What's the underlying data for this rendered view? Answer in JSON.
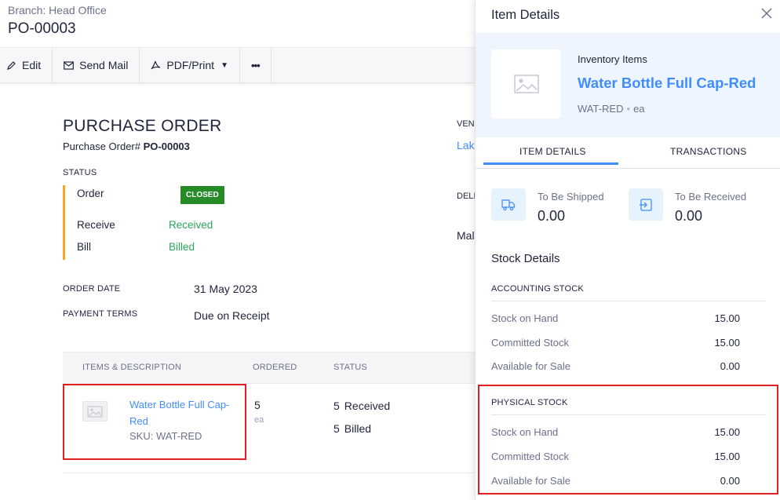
{
  "header": {
    "branch": "Branch: Head Office",
    "po_number": "PO-00003"
  },
  "toolbar": {
    "edit": "Edit",
    "send_mail": "Send Mail",
    "pdf_print": "PDF/Print",
    "more": "•••"
  },
  "document": {
    "title": "PURCHASE ORDER",
    "po_label": "Purchase Order#",
    "po_number": "PO-00003",
    "status_label": "STATUS",
    "status": {
      "order_label": "Order",
      "order_value": "CLOSED",
      "receive_label": "Receive",
      "receive_value": "Received",
      "bill_label": "Bill",
      "bill_value": "Billed"
    },
    "order_date_label": "ORDER DATE",
    "order_date": "31 May 2023",
    "payment_terms_label": "PAYMENT TERMS",
    "payment_terms": "Due on Receipt",
    "vendor_cut": "VEN",
    "vendor_link_cut": "Lak",
    "deliver_cut": "DELI",
    "deliver_val_cut": "Mal"
  },
  "items_table": {
    "headers": [
      "ITEMS & DESCRIPTION",
      "ORDERED",
      "STATUS"
    ],
    "rows": [
      {
        "name": "Water Bottle Full Cap-Red",
        "sku": "SKU: WAT-RED",
        "ordered": "5",
        "unit": "ea",
        "received_qty": "5",
        "received_label": "Received",
        "billed_qty": "5",
        "billed_label": "Billed"
      }
    ]
  },
  "panel": {
    "title": "Item Details",
    "item_type": "Inventory Items",
    "item_name": "Water Bottle Full Cap-Red",
    "item_sku": "WAT-RED",
    "item_unit": "ea",
    "tabs": [
      "ITEM DETAILS",
      "TRANSACTIONS"
    ],
    "to_be_shipped_label": "To Be Shipped",
    "to_be_shipped": "0.00",
    "to_be_received_label": "To Be Received",
    "to_be_received": "0.00",
    "stock_title": "Stock Details",
    "accounting": {
      "title": "ACCOUNTING STOCK",
      "rows": [
        {
          "label": "Stock on Hand",
          "value": "15.00"
        },
        {
          "label": "Committed Stock",
          "value": "15.00"
        },
        {
          "label": "Available for Sale",
          "value": "0.00"
        }
      ]
    },
    "physical": {
      "title": "PHYSICAL STOCK",
      "rows": [
        {
          "label": "Stock on Hand",
          "value": "15.00"
        },
        {
          "label": "Committed Stock",
          "value": "15.00"
        },
        {
          "label": "Available for Sale",
          "value": "0.00"
        }
      ]
    }
  },
  "colors": {
    "accent": "#408dfb",
    "closed_badge": "#268a27",
    "status_green": "#2aa45b",
    "status_bar": "#f5a623",
    "highlight": "#e02020"
  }
}
